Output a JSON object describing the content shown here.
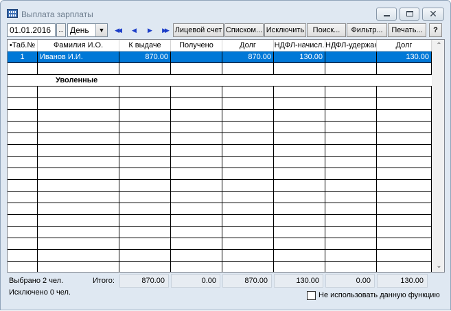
{
  "window": {
    "title": "Выплата зарплаты"
  },
  "icons": {
    "app": "spreadsheet-icon",
    "minimize": "minimize-icon",
    "maximize": "maximize-icon",
    "close": "close-icon",
    "close_glyph": "✕",
    "date_picker_glyph": "...",
    "dropdown_glyph": "▼",
    "nav_first": "◀◀",
    "nav_prev": "◀",
    "nav_next": "▶",
    "nav_last": "▶▶",
    "scroll_up": "⌃",
    "scroll_down": "⌄"
  },
  "toolbar": {
    "date": "01.01.2016",
    "period": "День",
    "buttons": {
      "account": "Лицевой счет",
      "list": "Списком...",
      "exclude": "Исключить",
      "search": "Поиск...",
      "filter": "Фильтр...",
      "print": "Печать...",
      "help": "?"
    }
  },
  "table": {
    "headers": [
      "•Таб.№",
      "Фамилия И.О.",
      "К выдаче",
      "Получено",
      "Долг",
      "НДФЛ-начисл.",
      "НДФЛ-удержан",
      "Долг"
    ],
    "rows": [
      [
        "1",
        "Иванов И.И.",
        "870.00",
        "",
        "870.00",
        "130.00",
        "",
        "130.00"
      ]
    ],
    "section_title": "Уволенные"
  },
  "colors": {
    "selection": "#0078d7"
  },
  "footer": {
    "selected": "Выбрано 2 чел.",
    "excluded": "Исключено 0 чел.",
    "total_label": "Итого:",
    "totals": [
      "870.00",
      "0.00",
      "870.00",
      "130.00",
      "0.00",
      "130.00"
    ],
    "checkbox_label": "Не использовать данную функцию"
  }
}
